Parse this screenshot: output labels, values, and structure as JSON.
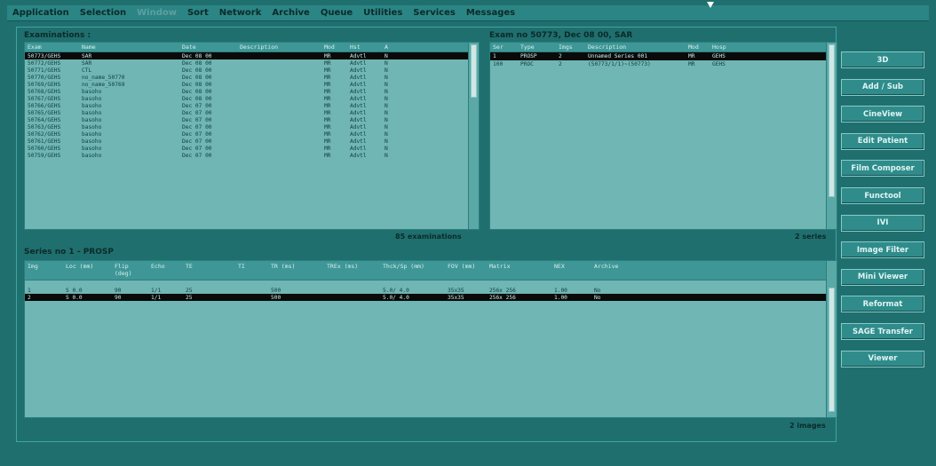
{
  "menu": [
    "Application",
    "Selection",
    "Window",
    "Sort",
    "Network",
    "Archive",
    "Queue",
    "Utilities",
    "Services",
    "Messages"
  ],
  "exams": {
    "title": "Examinations :",
    "columns": [
      "Exam",
      "Name",
      "Date",
      "Description",
      "Mod",
      "Hst",
      "A"
    ],
    "rows": [
      [
        "50773/GEHS",
        "SAR",
        "Dec 08 00",
        "",
        "MR",
        "Advtl",
        "N"
      ],
      [
        "50772/GEHS",
        "SAR",
        "Dec 08 00",
        "",
        "MR",
        "Advtl",
        "N"
      ],
      [
        "50771/GEHS",
        "CTL",
        "Dec 08 00",
        "",
        "MR",
        "Advtl",
        "N"
      ],
      [
        "50770/GEHS",
        "no_name_50770",
        "Dec 08 00",
        "",
        "MR",
        "Advtl",
        "N"
      ],
      [
        "50769/GEHS",
        "no_name_50769",
        "Dec 08 00",
        "",
        "MR",
        "Advtl",
        "N"
      ],
      [
        "50768/GEHS",
        "basoho",
        "Dec 08 00",
        "",
        "MR",
        "Advtl",
        "N"
      ],
      [
        "50767/GEHS",
        "basoho",
        "Dec 08 00",
        "",
        "MR",
        "Advtl",
        "N"
      ],
      [
        "50766/GEHS",
        "basoho",
        "Dec 07 00",
        "",
        "MR",
        "Advtl",
        "N"
      ],
      [
        "50765/GEHS",
        "basoho",
        "Dec 07 00",
        "",
        "MR",
        "Advtl",
        "N"
      ],
      [
        "50764/GEHS",
        "basoho",
        "Dec 07 00",
        "",
        "MR",
        "Advtl",
        "N"
      ],
      [
        "50763/GEHS",
        "basoho",
        "Dec 07 00",
        "",
        "MR",
        "Advtl",
        "N"
      ],
      [
        "50762/GEHS",
        "basoho",
        "Dec 07 00",
        "",
        "MR",
        "Advtl",
        "N"
      ],
      [
        "50761/GEHS",
        "basoho",
        "Dec 07 00",
        "",
        "MR",
        "Advtl",
        "N"
      ],
      [
        "50760/GEHS",
        "basoho",
        "Dec 07 00",
        "",
        "MR",
        "Advtl",
        "N"
      ],
      [
        "50759/GEHS",
        "basoho",
        "Dec 07 00",
        "",
        "MR",
        "Advtl",
        "N"
      ]
    ],
    "selected_index": 0,
    "count": "85 examinations"
  },
  "series": {
    "title": "Exam no 50773, Dec 08 00, SAR",
    "columns": [
      "Ser",
      "Type",
      "Imgs",
      "Description",
      "Mod",
      "Hosp"
    ],
    "rows": [
      [
        "1",
        "PROSP",
        "2",
        "Unnamed Series 001",
        "MR",
        "GEHS"
      ],
      [
        "100",
        "PROC",
        "2",
        "(50773/1/1)~(50773)",
        "MR",
        "GEHS"
      ]
    ],
    "selected_index": 0,
    "count": "2 series"
  },
  "images": {
    "title": "Series no 1 - PROSP",
    "columns": [
      "Img",
      "Loc (mm)",
      "Flip (deg)",
      "Echo",
      "TE",
      "TI",
      "TR (ms)",
      "TREx (ms)",
      "Thck/Sp (mm)",
      "FOV (mm)",
      "Matrix",
      "NEX",
      "Archive"
    ],
    "rows": [
      [
        "1",
        "S 0.0",
        "90",
        "1/1",
        "25",
        "",
        "500",
        "",
        "5.0/ 4.0",
        "35x35",
        "256x 256",
        "1.00",
        "No"
      ],
      [
        "2",
        "S 0.0",
        "90",
        "1/1",
        "25",
        "",
        "500",
        "",
        "5.0/ 4.0",
        "35x35",
        "256x 256",
        "1.00",
        "No"
      ]
    ],
    "selected_index": 1,
    "count": "2 images"
  },
  "buttons": [
    "3D",
    "Add / Sub",
    "CineView",
    "Edit Patient",
    "Film Composer",
    "Functool",
    "IVI",
    "Image Filter",
    "Mini Viewer",
    "Reformat",
    "SAGE Transfer",
    "Viewer"
  ],
  "colors": {
    "background": "#1f6f6e",
    "list_background": "#6fb6b4",
    "selection": "#0a0a0a",
    "button": "#2f8c8b"
  }
}
